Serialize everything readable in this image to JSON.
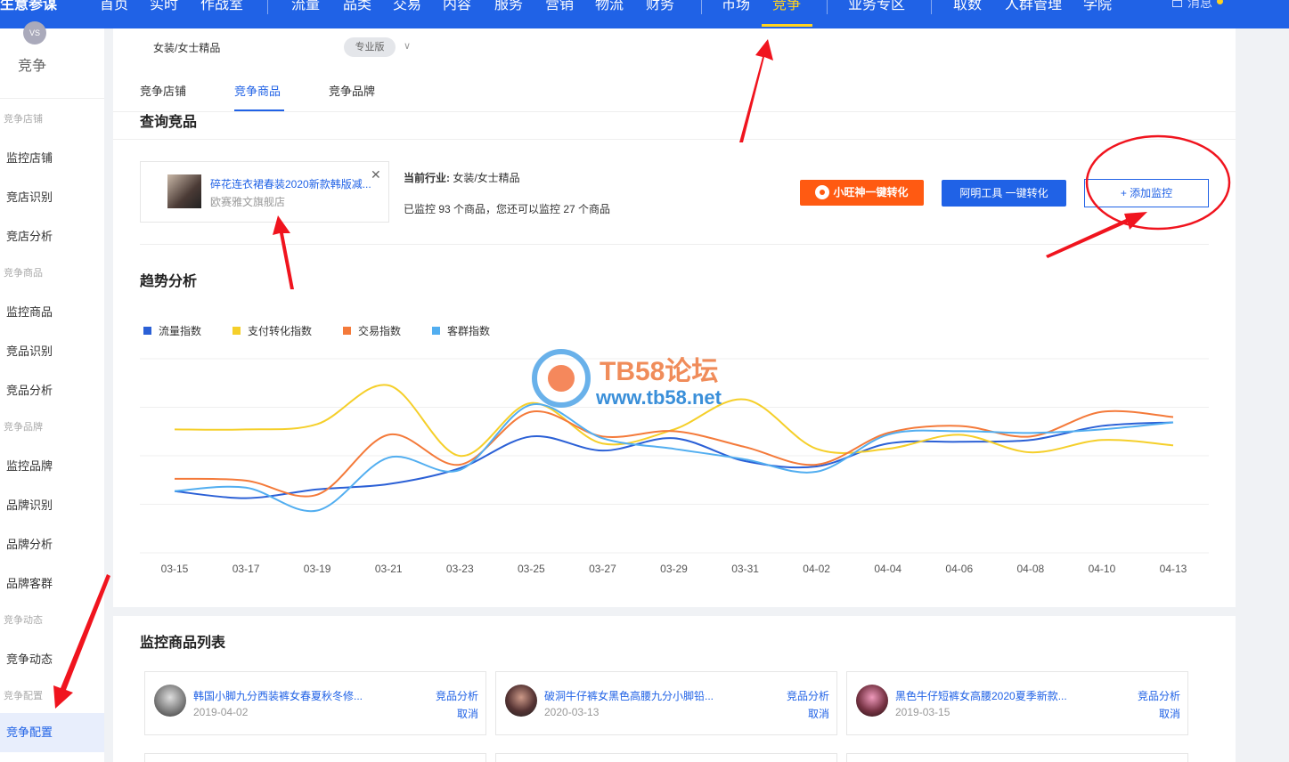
{
  "topnav": {
    "brand": "生意参谋",
    "items": [
      "首页",
      "实时",
      "作战室",
      "流量",
      "品类",
      "交易",
      "内容",
      "服务",
      "营销",
      "物流",
      "财务",
      "市场",
      "竞争",
      "业务专区",
      "取数",
      "人群管理",
      "学院"
    ],
    "active_item": "竞争",
    "message_label": "消息"
  },
  "sidebar": {
    "logo_label": "竞争",
    "groups": [
      {
        "label": "竞争店铺",
        "items": [
          "监控店铺",
          "竞店识别",
          "竞店分析"
        ]
      },
      {
        "label": "竞争商品",
        "items": [
          "监控商品",
          "竞品识别",
          "竞品分析"
        ]
      },
      {
        "label": "竞争品牌",
        "items": [
          "监控品牌",
          "品牌识别",
          "品牌分析",
          "品牌客群"
        ]
      },
      {
        "label": "竞争动态",
        "items": [
          "竞争动态"
        ]
      },
      {
        "label": "竞争配置",
        "items": [
          "竞争配置"
        ]
      }
    ],
    "active_item": "竞争配置"
  },
  "header": {
    "breadcrumb": "女装/女士精品",
    "edition_badge": "专业版",
    "tabs": [
      "竞争店铺",
      "竞争商品",
      "竞争品牌"
    ],
    "active_tab": "竞争商品"
  },
  "main": {
    "section_title": "查询竞品",
    "product": {
      "name": "碎花连衣裙春装2020新款韩版减...",
      "shop": "欧赛雅文旗舰店"
    },
    "industry_label": "当前行业:",
    "industry_value": "女装/女士精品",
    "monitor_text": "已监控 93 个商品，您还可以监控 27 个商品",
    "buttons": {
      "xiaowang": "小旺神一键转化",
      "aming": "阿明工具 一键转化",
      "add_monitor": "+ 添加监控"
    },
    "trend_title": "趋势分析"
  },
  "colors": {
    "primary": "#2062e6",
    "orange_button": "#ff5a12",
    "series_traffic": "#2b60d6",
    "series_conversion": "#f5cf2a",
    "series_trade": "#f47a3a",
    "series_customer": "#52aef0",
    "annotation": "#f0141e"
  },
  "chart_data": {
    "type": "line",
    "x": [
      "03-15",
      "03-17",
      "03-19",
      "03-21",
      "03-23",
      "03-25",
      "03-27",
      "03-29",
      "03-31",
      "04-02",
      "04-04",
      "04-06",
      "04-08",
      "04-10",
      "04-13"
    ],
    "series": [
      {
        "name": "流量指数",
        "values": [
          0.35,
          0.31,
          0.36,
          0.39,
          0.48,
          0.66,
          0.58,
          0.65,
          0.52,
          0.49,
          0.62,
          0.63,
          0.64,
          0.72,
          0.74
        ]
      },
      {
        "name": "支付转化指数",
        "values": [
          0.7,
          0.7,
          0.73,
          0.95,
          0.55,
          0.85,
          0.62,
          0.7,
          0.87,
          0.59,
          0.59,
          0.67,
          0.57,
          0.64,
          0.61
        ]
      },
      {
        "name": "交易指数",
        "values": [
          0.42,
          0.41,
          0.33,
          0.67,
          0.5,
          0.8,
          0.66,
          0.69,
          0.6,
          0.5,
          0.68,
          0.72,
          0.66,
          0.8,
          0.77
        ]
      },
      {
        "name": "客群指数",
        "values": [
          0.35,
          0.37,
          0.24,
          0.54,
          0.47,
          0.84,
          0.65,
          0.59,
          0.53,
          0.46,
          0.67,
          0.69,
          0.68,
          0.7,
          0.74
        ]
      }
    ],
    "ylim": [
      0,
      1
    ],
    "grid": true,
    "legend": "top-left"
  },
  "watermark": {
    "title": "TB58论坛",
    "url": "www.tb58.net"
  },
  "list": {
    "title": "监控商品列表",
    "items": [
      {
        "name": "韩国小脚九分西装裤女春夏秋冬修...",
        "date": "2019-04-02",
        "analyze": "竞品分析",
        "cancel": "取消"
      },
      {
        "name": "破洞牛仔裤女黑色高腰九分小脚铅...",
        "date": "2020-03-13",
        "analyze": "竞品分析",
        "cancel": "取消"
      },
      {
        "name": "黑色牛仔短裤女高腰2020夏季新款...",
        "date": "2019-03-15",
        "analyze": "竞品分析",
        "cancel": "取消"
      }
    ]
  }
}
